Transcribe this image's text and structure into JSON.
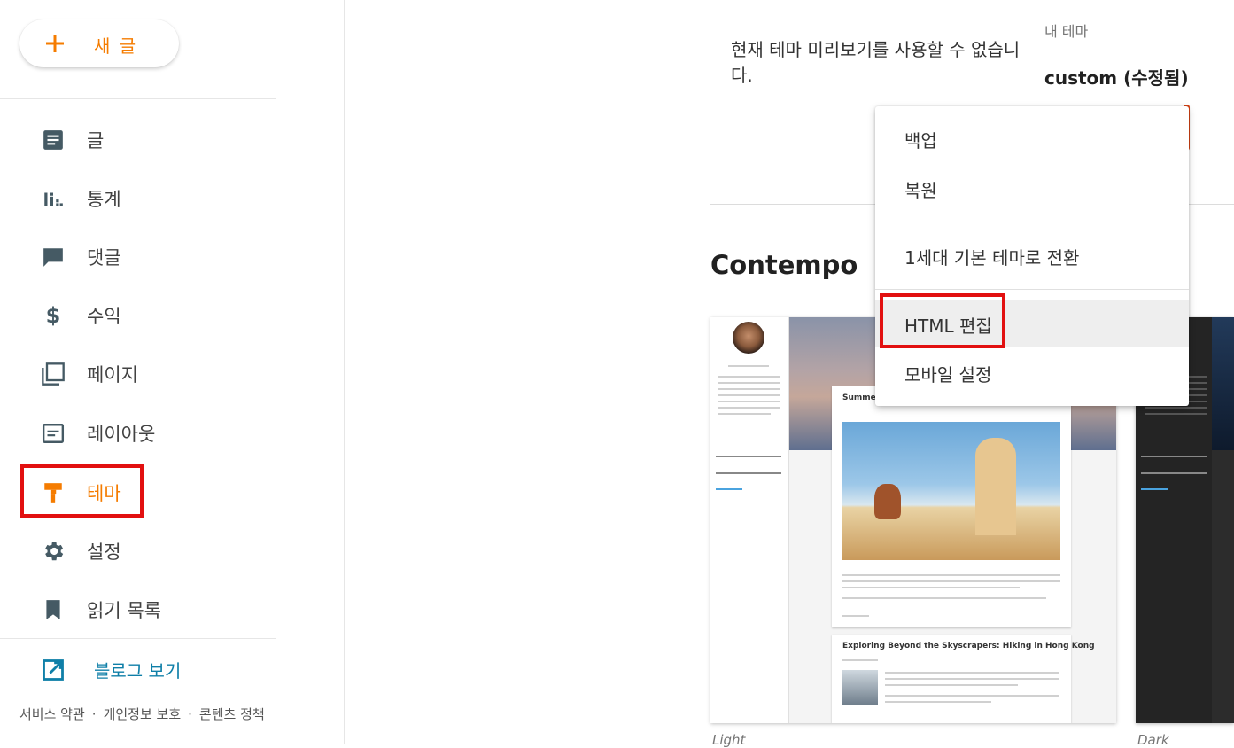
{
  "sidebar": {
    "new_post_label": "새 글",
    "items": [
      {
        "key": "posts",
        "label": "글",
        "icon": "document-icon"
      },
      {
        "key": "stats",
        "label": "통계",
        "icon": "bar-chart-icon"
      },
      {
        "key": "comments",
        "label": "댓글",
        "icon": "comment-icon"
      },
      {
        "key": "earnings",
        "label": "수익",
        "icon": "dollar-icon"
      },
      {
        "key": "pages",
        "label": "페이지",
        "icon": "pages-icon"
      },
      {
        "key": "layout",
        "label": "레이아웃",
        "icon": "layout-icon"
      },
      {
        "key": "theme",
        "label": "테마",
        "icon": "paint-roller-icon",
        "active": true
      },
      {
        "key": "settings",
        "label": "설정",
        "icon": "gear-icon"
      },
      {
        "key": "reading_list",
        "label": "읽기 목록",
        "icon": "bookmark-icon"
      }
    ],
    "view_blog_label": "블로그 보기",
    "footer": {
      "terms": "서비스 약관",
      "privacy": "개인정보 보호",
      "content_policy": "콘텐츠 정책",
      "separator": "·"
    }
  },
  "main": {
    "preview_unavailable": "현재 테마 미리보기를 사용할 수 없습니다.",
    "my_theme_label": "내 테마",
    "my_theme_name": "custom (수정됨)",
    "section_title": "Contempo",
    "cards": [
      {
        "caption": "Light"
      },
      {
        "caption": "Dark"
      }
    ]
  },
  "menu": {
    "items": [
      "백업",
      "복원",
      "1세대 기본 테마로 전환",
      "HTML 편집",
      "모바일 설정"
    ]
  },
  "colors": {
    "accent": "#f57c00",
    "highlight_box": "#e21010",
    "link": "#0f7fa8"
  }
}
